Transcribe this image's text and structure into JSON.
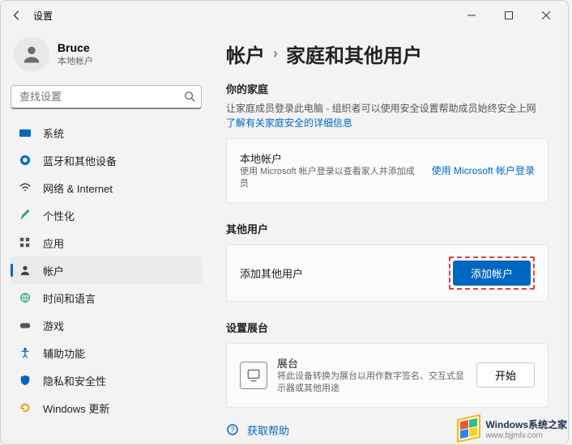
{
  "window": {
    "title": "设置"
  },
  "user": {
    "name": "Bruce",
    "type": "本地帐户"
  },
  "search": {
    "placeholder": "查找设置"
  },
  "sidebar": {
    "items": [
      {
        "icon": "system",
        "label": "系统"
      },
      {
        "icon": "bluetooth",
        "label": "蓝牙和其他设备"
      },
      {
        "icon": "network",
        "label": "网络 & Internet"
      },
      {
        "icon": "personalize",
        "label": "个性化"
      },
      {
        "icon": "apps",
        "label": "应用"
      },
      {
        "icon": "accounts",
        "label": "帐户",
        "active": true
      },
      {
        "icon": "time",
        "label": "时间和语言"
      },
      {
        "icon": "gaming",
        "label": "游戏"
      },
      {
        "icon": "accessibility",
        "label": "辅助功能"
      },
      {
        "icon": "privacy",
        "label": "隐私和安全性"
      },
      {
        "icon": "update",
        "label": "Windows 更新"
      }
    ]
  },
  "main": {
    "breadcrumb": {
      "root": "帐户",
      "page": "家庭和其他用户"
    },
    "family": {
      "heading": "你的家庭",
      "desc": "让家庭成员登录此电脑 - 组织者可以使用安全设置帮助成员始终安全上网",
      "link": "了解有关家庭安全的详细信息",
      "local_title": "本地帐户",
      "local_desc": "使用 Microsoft 帐户登录以查看家人并添加成员",
      "signin": "使用 Microsoft 帐户登录"
    },
    "other": {
      "heading": "其他用户",
      "row_label": "添加其他用户",
      "add_btn": "添加帐户"
    },
    "kiosk": {
      "heading": "设置展台",
      "title": "展台",
      "desc": "将此设备转换为展台以用作数字签名、交互式显示器或其他用途",
      "start_btn": "开始"
    },
    "help": "获取帮助"
  },
  "watermark": {
    "title": "Windows系统之家",
    "url": "www.bjjmlv.com"
  }
}
